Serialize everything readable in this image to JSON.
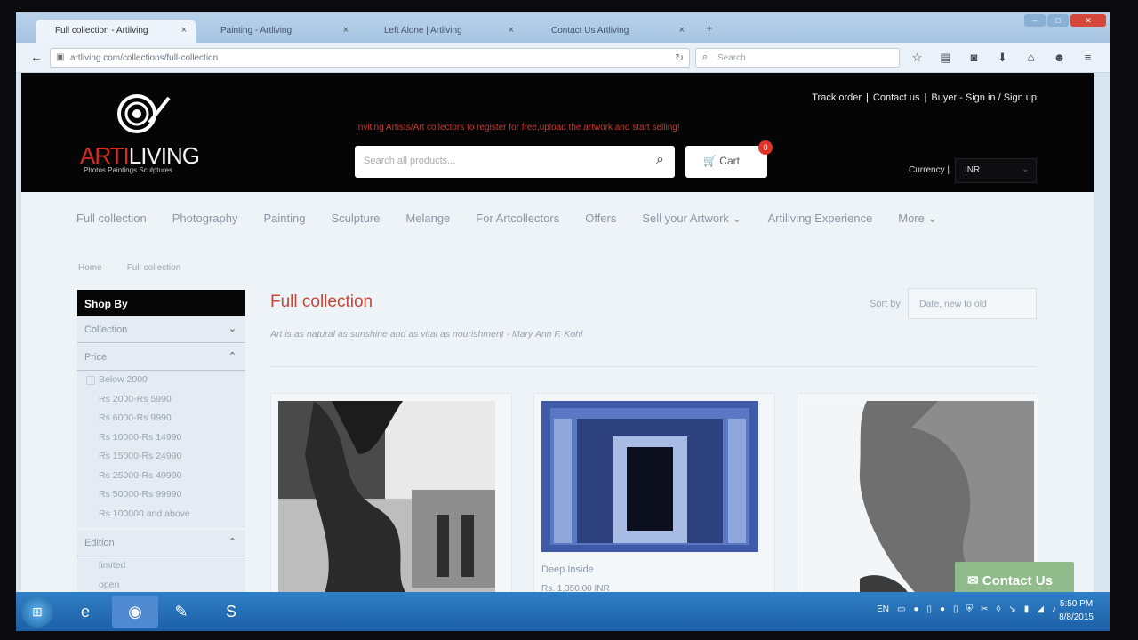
{
  "browser": {
    "tabs": [
      {
        "label": "Full collection - Artilving",
        "active": true
      },
      {
        "label": "Painting - Artliving",
        "active": false
      },
      {
        "label": "Left Alone | Artliving",
        "active": false
      },
      {
        "label": "Contact Us Artliving",
        "active": false
      }
    ],
    "new_tab_symbol": "+",
    "url": "artliving.com/collections/full-collection",
    "search_placeholder": "Search"
  },
  "header": {
    "logo_text_a": "ARTI",
    "logo_text_b": "LIVING",
    "logo_tagline": "Photos Paintings Sculptures",
    "links": [
      "Track order",
      "Contact us",
      "Buyer - Sign in / Sign up"
    ],
    "promo": "Inviting Artists/Art collectors to register for free,upload the artwork and start selling!",
    "search_placeholder": "Search all products...",
    "cart_label": "Cart",
    "cart_count": "0",
    "currency_label": "Currency |",
    "currency_value": "INR"
  },
  "nav": {
    "items": [
      "Full collection",
      "Photography",
      "Painting",
      "Sculpture",
      "Melange",
      "For Artcollectors",
      "Offers",
      "Sell your Artwork",
      "Artiliving Experience",
      "More"
    ]
  },
  "breadcrumb": [
    "Home",
    "Full collection"
  ],
  "sidebar": {
    "title": "Shop By",
    "collection_label": "Collection",
    "price_label": "Price",
    "price_options": [
      "Below 2000",
      "Rs 2000-Rs 5990",
      "Rs 6000-Rs 9990",
      "Rs 10000-Rs 14990",
      "Rs 15000-Rs 24990",
      "Rs 25000-Rs 49990",
      "Rs 50000-Rs 99990",
      "Rs 100000 and above"
    ],
    "edition_label": "Edition",
    "edition_options": [
      "limited",
      "open"
    ]
  },
  "main": {
    "title": "Full collection",
    "quote": "Art is as natural as sunshine and as vital as nourishment - Mary Ann F. Kohl",
    "sort_label": "Sort by",
    "sort_value": "Date, new to old"
  },
  "products": [
    {
      "title": "",
      "price": ""
    },
    {
      "title": "Deep Inside",
      "price": "Rs. 1,350.00 INR"
    },
    {
      "title": "",
      "price": ""
    }
  ],
  "contact_button": "Contact Us",
  "taskbar": {
    "lang": "EN",
    "time": "5:50 PM",
    "date": "8/8/2015"
  }
}
